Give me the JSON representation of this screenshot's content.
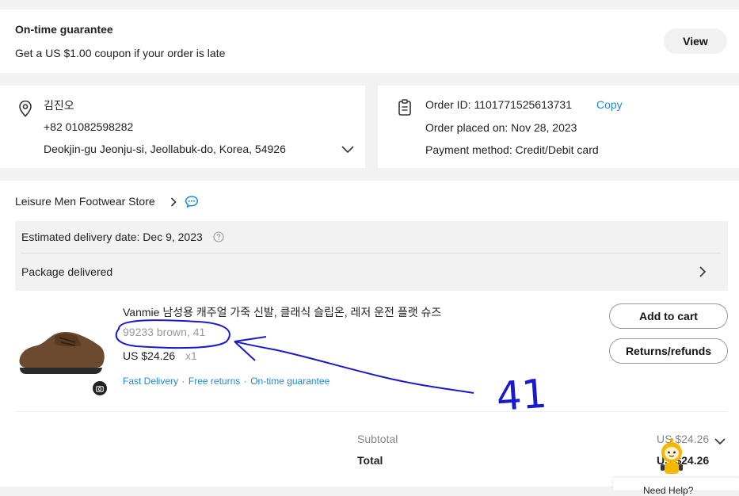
{
  "guarantee": {
    "title": "On-time guarantee",
    "text": "Get a US $1.00 coupon if your order is late",
    "button": "View"
  },
  "address": {
    "name": "김진오",
    "phone": "+82 01082598282",
    "address": "Deokjin-gu Jeonju-si, Jeollabuk-do, Korea, 54926"
  },
  "order": {
    "id": "Order ID: 1101771525613731",
    "copy": "Copy",
    "placed": "Order placed on: Nov 28, 2023",
    "payment": "Payment method: Credit/Debit card"
  },
  "store": {
    "name": "Leisure Men Footwear Store"
  },
  "delivery": {
    "estimated": "Estimated delivery date: Dec 9, 2023",
    "status": "Package delivered"
  },
  "product": {
    "title": "Vanmie 남성용 캐주얼 가죽 신발, 클래식 슬립온, 레저 운전 플랫 슈즈",
    "variant": "99233 brown, 41",
    "price": "US $24.26",
    "qty": "x1",
    "tag1": "Fast Delivery",
    "sep1": "·",
    "tag2": "Free returns",
    "sep2": "·",
    "tag3": "On-time guarantee",
    "add_to_cart": "Add to cart",
    "returns": "Returns/refunds"
  },
  "summary": {
    "subtotal_label": "Subtotal",
    "subtotal_value": "US $24.26",
    "total_label": "Total",
    "total_value": "US $24.26"
  },
  "help": {
    "text": "Need Help?"
  },
  "annotation": {
    "handwritten": "41"
  },
  "colors": {
    "link": "#1a8ad9",
    "annotation": "#1a1acd"
  }
}
